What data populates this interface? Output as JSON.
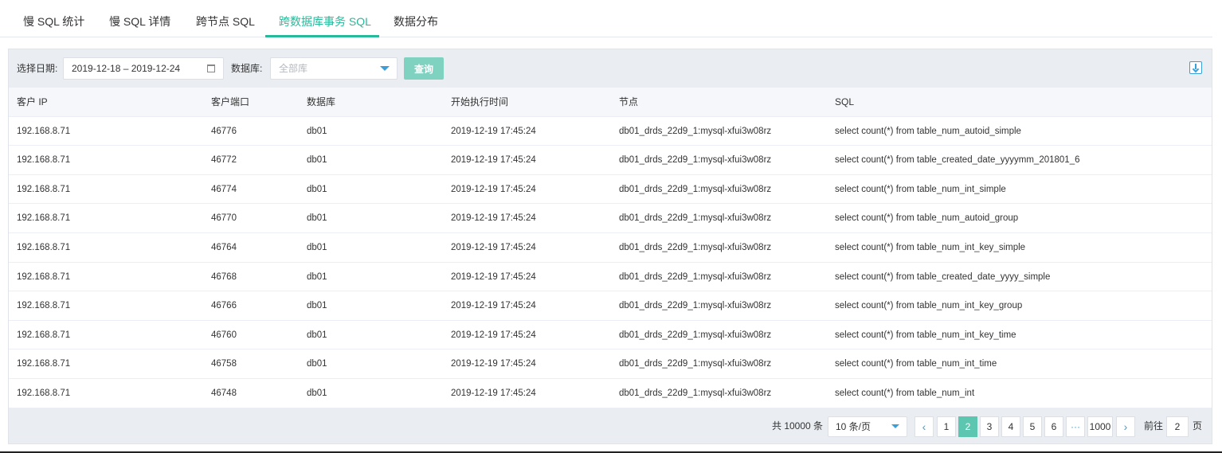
{
  "tabs": [
    {
      "label": "慢 SQL 统计",
      "active": false
    },
    {
      "label": "慢 SQL 详情",
      "active": false
    },
    {
      "label": "跨节点 SQL",
      "active": false
    },
    {
      "label": "跨数据库事务 SQL",
      "active": true
    },
    {
      "label": "数据分布",
      "active": false
    }
  ],
  "filters": {
    "date_label": "选择日期:",
    "date_range": "2019-12-18 – 2019-12-24",
    "db_label": "数据库:",
    "db_placeholder": "全部库",
    "query_label": "查询"
  },
  "icons": {
    "calendar": "calendar-icon",
    "select_caret": "chevron-down-icon",
    "download": "download-icon"
  },
  "accent_color": "#26b99a",
  "table": {
    "columns": [
      "客户 IP",
      "客户端口",
      "数据库",
      "开始执行时间",
      "节点",
      "SQL"
    ],
    "rows": [
      [
        "192.168.8.71",
        "46776",
        "db01",
        "2019-12-19 17:45:24",
        "db01_drds_22d9_1:mysql-xfui3w08rz",
        "select count(*) from table_num_autoid_simple"
      ],
      [
        "192.168.8.71",
        "46772",
        "db01",
        "2019-12-19 17:45:24",
        "db01_drds_22d9_1:mysql-xfui3w08rz",
        "select count(*) from table_created_date_yyyymm_201801_6"
      ],
      [
        "192.168.8.71",
        "46774",
        "db01",
        "2019-12-19 17:45:24",
        "db01_drds_22d9_1:mysql-xfui3w08rz",
        "select count(*) from table_num_int_simple"
      ],
      [
        "192.168.8.71",
        "46770",
        "db01",
        "2019-12-19 17:45:24",
        "db01_drds_22d9_1:mysql-xfui3w08rz",
        "select count(*) from table_num_autoid_group"
      ],
      [
        "192.168.8.71",
        "46764",
        "db01",
        "2019-12-19 17:45:24",
        "db01_drds_22d9_1:mysql-xfui3w08rz",
        "select count(*) from table_num_int_key_simple"
      ],
      [
        "192.168.8.71",
        "46768",
        "db01",
        "2019-12-19 17:45:24",
        "db01_drds_22d9_1:mysql-xfui3w08rz",
        "select count(*) from table_created_date_yyyy_simple"
      ],
      [
        "192.168.8.71",
        "46766",
        "db01",
        "2019-12-19 17:45:24",
        "db01_drds_22d9_1:mysql-xfui3w08rz",
        "select count(*) from table_num_int_key_group"
      ],
      [
        "192.168.8.71",
        "46760",
        "db01",
        "2019-12-19 17:45:24",
        "db01_drds_22d9_1:mysql-xfui3w08rz",
        "select count(*) from table_num_int_key_time"
      ],
      [
        "192.168.8.71",
        "46758",
        "db01",
        "2019-12-19 17:45:24",
        "db01_drds_22d9_1:mysql-xfui3w08rz",
        "select count(*) from table_num_int_time"
      ],
      [
        "192.168.8.71",
        "46748",
        "db01",
        "2019-12-19 17:45:24",
        "db01_drds_22d9_1:mysql-xfui3w08rz",
        "select count(*) from table_num_int"
      ]
    ]
  },
  "pagination": {
    "total_text": "共 10000 条",
    "page_size": "10 条/页",
    "prev": "‹",
    "next": "›",
    "pages": [
      "1",
      "2",
      "3",
      "4",
      "5",
      "6",
      "···",
      "1000"
    ],
    "current_page": "2",
    "goto_prefix": "前往",
    "goto_value": "2",
    "goto_suffix": "页"
  }
}
